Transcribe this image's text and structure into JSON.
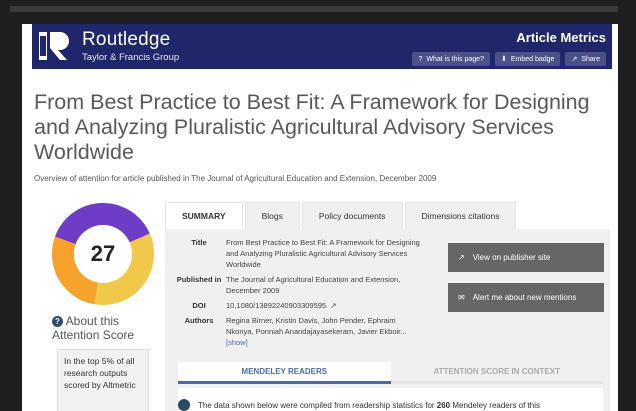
{
  "header": {
    "brand": "Routledge",
    "brand_sub": "Taylor & Francis Group",
    "section_title": "Article Metrics",
    "buttons": [
      {
        "label": "What is this page?",
        "icon": "question-icon"
      },
      {
        "label": "Embed badge",
        "icon": "download-icon"
      },
      {
        "label": "Share",
        "icon": "share-icon"
      }
    ]
  },
  "article": {
    "title": "From Best Practice to Best Fit: A Framework for Designing and Analyzing Pluralistic Agricultural Advisory Services Worldwide",
    "subtitle": "Overview of attention for article published in The Journal of Agricultural Education and Extension, December 2009"
  },
  "score": {
    "value": "27",
    "about": "About this Attention Score",
    "top_percent_text": "In the top 5% of all research outputs scored by Altmetric"
  },
  "tabs": [
    "SUMMARY",
    "Blogs",
    "Policy documents",
    "Dimensions citations"
  ],
  "details": {
    "title_label": "Title",
    "title_value": "From Best Practice to Best Fit: A Framework for Designing and Analyzing Pluralistic Agricultural Advisory Services Worldwide",
    "published_label": "Published in",
    "published_value": "The Journal of Agricultural Education and Extension, December 2009",
    "doi_label": "DOI",
    "doi_value": "10.1080/13892240903309595",
    "authors_label": "Authors",
    "authors_value": "Regina Birner, Kristin Davis, John Pender, Ephraim Nkonya, Ponniah Anandajayasekeram, Javier Ekboir...",
    "show_label": "[show]"
  },
  "actions": {
    "publisher": "View on publisher site",
    "alert": "Alert me about new mentions"
  },
  "mendeley": {
    "tab_readers": "MENDELEY READERS",
    "tab_context": "ATTENTION SCORE IN CONTEXT",
    "info_prefix": "The data shown below were compiled from readership statistics for ",
    "info_count": "260",
    "info_suffix": " Mendeley readers of this"
  },
  "colors": {
    "header_bg": "#20266a",
    "accent": "#4a6da7",
    "donut_orange": "#f7a22c",
    "donut_purple": "#6e3dc8",
    "donut_yellow": "#f2c84b"
  }
}
